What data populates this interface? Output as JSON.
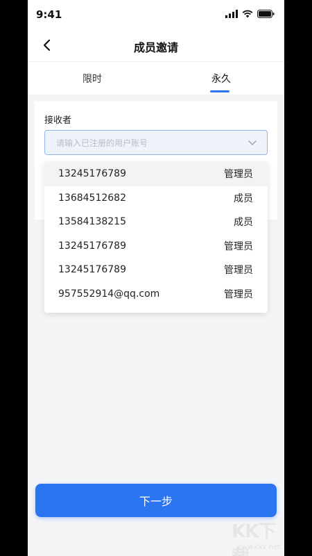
{
  "status_bar": {
    "time": "9:41"
  },
  "nav": {
    "title": "成员邀请"
  },
  "tabs": [
    {
      "label": "限时",
      "active": false
    },
    {
      "label": "永久",
      "active": true
    }
  ],
  "form": {
    "receiver_label": "接收者",
    "receiver_placeholder": "请输入已注册的用户账号"
  },
  "dropdown": {
    "items": [
      {
        "account": "13245176789",
        "role": "管理员"
      },
      {
        "account": "13684512682",
        "role": "成员"
      },
      {
        "account": "13584138215",
        "role": "成员"
      },
      {
        "account": "13245176789",
        "role": "管理员"
      },
      {
        "account": "13245176789",
        "role": "管理员"
      },
      {
        "account": "957552914@qq.com",
        "role": "管理员"
      }
    ]
  },
  "footer": {
    "next_label": "下一步"
  },
  "watermark": {
    "main": "KK下载",
    "sub": "www.kkx.net"
  },
  "colors": {
    "accent": "#2b76f0",
    "background": "#f4f5f7"
  },
  "icons": {
    "back": "chevron-left-icon",
    "dropdown": "chevron-down-icon"
  }
}
